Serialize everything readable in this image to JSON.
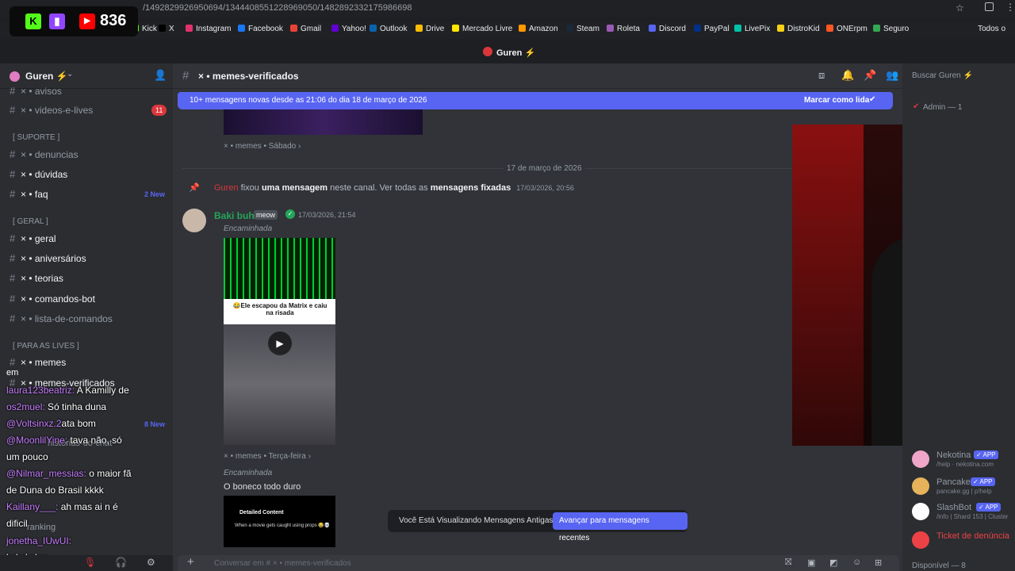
{
  "browser": {
    "url": "/1492829926950694/1344408551228969050/1482892332175986698",
    "bookmarks": [
      {
        "label": "Kick",
        "color": "#53fc18"
      },
      {
        "label": "X",
        "color": "#000000"
      },
      {
        "label": "Instagram",
        "color": "#e1306c"
      },
      {
        "label": "Facebook",
        "color": "#1877f2"
      },
      {
        "label": "Gmail",
        "color": "#ea4335"
      },
      {
        "label": "Yahoo!",
        "color": "#6001d2"
      },
      {
        "label": "Outlook",
        "color": "#0a64ad"
      },
      {
        "label": "Drive",
        "color": "#fbbc04"
      },
      {
        "label": "Mercado Livre",
        "color": "#ffe600"
      },
      {
        "label": "Amazon",
        "color": "#ff9900"
      },
      {
        "label": "Steam",
        "color": "#1b2838"
      },
      {
        "label": "Roleta",
        "color": "#9b59b6"
      },
      {
        "label": "Discord",
        "color": "#5865f2"
      },
      {
        "label": "PayPal",
        "color": "#003087"
      },
      {
        "label": "LivePix",
        "color": "#00c2a8"
      },
      {
        "label": "DistroKid",
        "color": "#f7d117"
      },
      {
        "label": "ONErpm",
        "color": "#ff5722"
      },
      {
        "label": "Seguro",
        "color": "#34a853"
      }
    ],
    "all_bookmarks": "Todos o"
  },
  "overlay": {
    "viewer_count": "836"
  },
  "server": {
    "title": "Guren ⚡",
    "name": "Guren ⚡"
  },
  "sidebar": {
    "channels_top": [
      {
        "label": "× • avisos",
        "dim": true
      },
      {
        "label": "× • videos-e-lives",
        "badge": "11"
      }
    ],
    "cat_suporte": "[ SUPORTE ]",
    "suporte": [
      {
        "label": "× • denuncias"
      },
      {
        "label": "× • dúvidas",
        "bright": true
      },
      {
        "label": "× • faq",
        "bright": true,
        "new": "2 New"
      }
    ],
    "cat_geral": "[ GERAL ]",
    "geral": [
      {
        "label": "× • geral",
        "bright": true
      },
      {
        "label": "× • aniversários",
        "bright": true
      },
      {
        "label": "× • teorias",
        "bright": true
      },
      {
        "label": "× • comandos-bot",
        "bright": true
      },
      {
        "label": "× • lista-de-comandos"
      }
    ],
    "cat_lives": "[ PARA AS LIVES ]",
    "lives": [
      {
        "label": "× • memes",
        "bright": true
      },
      {
        "label": "× • memes-verificados",
        "bright": true
      }
    ],
    "new8": "8 New",
    "hist": "historias-do-chat",
    "ranking": "ranking"
  },
  "stream_chat": [
    {
      "user": "laura123beatriz:",
      "text": " A Kamilly de",
      "prefix": "em"
    },
    {
      "user": "os2muel:",
      "text": " Só tinha duna"
    },
    {
      "user": "@Voltsinxz.2",
      "text": "ata bom"
    },
    {
      "user": "@MoonlilYine:",
      "text": " tava não, só"
    },
    {
      "user": "",
      "text": "um pouco"
    },
    {
      "user": "@Nilmar_messias:",
      "text": " o maior fã"
    },
    {
      "user": "",
      "text": "de Duna do Brasil kkkk"
    },
    {
      "user": "Kaillany___:",
      "text": " ah mas ai n é"
    },
    {
      "user": "",
      "text": "dificil"
    },
    {
      "user": "jonetha_IUwUI:",
      "text": ""
    },
    {
      "user": "",
      "text": "kskskskss"
    }
  ],
  "channel": {
    "name": "× • memes-verificados",
    "banner": "10+ mensagens novas desde as 21:06 do dia 18 de março de 2026",
    "mark_read": "Marcar como lida",
    "search": "Buscar Guren ⚡",
    "src1": "× • memes • Sábado ›",
    "date_divider": "17 de março de 2026",
    "pin_user": "Guren",
    "pin_text1": " fixou ",
    "pin_bold1": "uma mensagem",
    "pin_text2": " neste canal. Ver todas as ",
    "pin_bold2": "mensagens fixadas",
    "pin_time": "17/03/2026, 20:56",
    "author": "Baki buh",
    "author_tag": "meow",
    "author_time": "17/03/2026, 21:54",
    "forwarded": "Encaminhada",
    "video_caption": "😂Ele escapou da Matrix e caiu na risada",
    "src2": "× • memes • Terça-feira ›",
    "forwarded2": "Encaminhada",
    "msg2": "O boneco todo duro",
    "embed2_title": "Detailed Content",
    "embed2_text": "When a movie gets caught using props 😂💀",
    "toast_text": "Você Está Visualizando Mensagens Antigas",
    "toast_btn": "Avançar para mensagens recentes",
    "composer": "Conversar em # × • memes-verificados"
  },
  "members": {
    "admin_header": "Admin — 1",
    "online_footer": "Disponível — 8",
    "apps": [
      {
        "name": "Nekotina",
        "sub": "/help · nekotina.com",
        "color": "#f0a6c8"
      },
      {
        "name": "Pancake",
        "sub": "pancake.gg | p!help",
        "color": "#e6b35a"
      },
      {
        "name": "SlashBot",
        "sub": "/info | Shard 153 | Cluster",
        "color": "#ffffff"
      },
      {
        "name": "Ticket de denúncia",
        "sub": "",
        "color": "#ed4245"
      }
    ],
    "app_badge": "✓ APP"
  },
  "colors": {
    "blurple": "#5865f2",
    "red": "#da373c",
    "green": "#23a55a"
  }
}
